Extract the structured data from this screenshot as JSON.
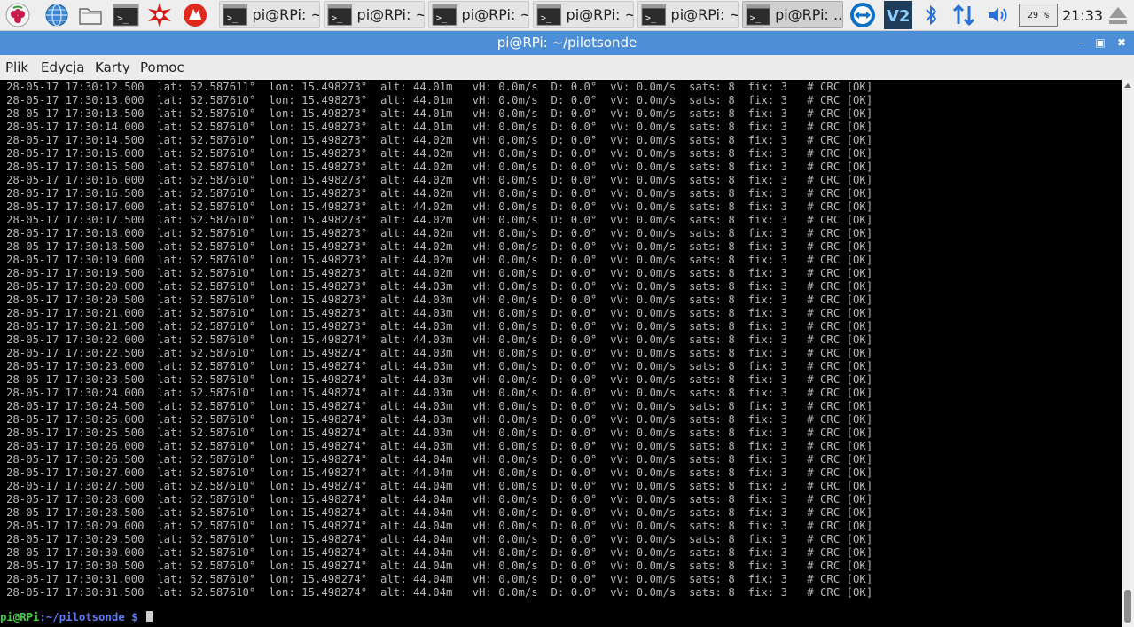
{
  "taskbar": {
    "tasks": [
      {
        "label": "pi@RPi: ~"
      },
      {
        "label": "pi@RPi: ~"
      },
      {
        "label": "pi@RPi: ~"
      },
      {
        "label": "pi@RPi: ~"
      },
      {
        "label": "pi@RPi: ~"
      },
      {
        "label": "pi@RPi: ..."
      }
    ],
    "battery": "29 %",
    "clock": "21:33"
  },
  "window": {
    "title": "pi@RPi: ~/pilotsonde"
  },
  "menu": {
    "items": [
      "Plik",
      "Edycja",
      "Karty",
      "Pomoc"
    ]
  },
  "terminal": {
    "lines": [
      "28-05-17 17:30:12.500  lat: 52.587611°  lon: 15.498273°  alt: 44.01m   vH: 0.0m/s  D: 0.0°  vV: 0.0m/s  sats: 8  fix: 3   # CRC [OK]",
      "28-05-17 17:30:13.000  lat: 52.587610°  lon: 15.498273°  alt: 44.01m   vH: 0.0m/s  D: 0.0°  vV: 0.0m/s  sats: 8  fix: 3   # CRC [OK]",
      "28-05-17 17:30:13.500  lat: 52.587610°  lon: 15.498273°  alt: 44.01m   vH: 0.0m/s  D: 0.0°  vV: 0.0m/s  sats: 8  fix: 3   # CRC [OK]",
      "28-05-17 17:30:14.000  lat: 52.587610°  lon: 15.498273°  alt: 44.01m   vH: 0.0m/s  D: 0.0°  vV: 0.0m/s  sats: 8  fix: 3   # CRC [OK]",
      "28-05-17 17:30:14.500  lat: 52.587610°  lon: 15.498273°  alt: 44.02m   vH: 0.0m/s  D: 0.0°  vV: 0.0m/s  sats: 8  fix: 3   # CRC [OK]",
      "28-05-17 17:30:15.000  lat: 52.587610°  lon: 15.498273°  alt: 44.02m   vH: 0.0m/s  D: 0.0°  vV: 0.0m/s  sats: 8  fix: 3   # CRC [OK]",
      "28-05-17 17:30:15.500  lat: 52.587610°  lon: 15.498273°  alt: 44.02m   vH: 0.0m/s  D: 0.0°  vV: 0.0m/s  sats: 8  fix: 3   # CRC [OK]",
      "28-05-17 17:30:16.000  lat: 52.587610°  lon: 15.498273°  alt: 44.02m   vH: 0.0m/s  D: 0.0°  vV: 0.0m/s  sats: 8  fix: 3   # CRC [OK]",
      "28-05-17 17:30:16.500  lat: 52.587610°  lon: 15.498273°  alt: 44.02m   vH: 0.0m/s  D: 0.0°  vV: 0.0m/s  sats: 8  fix: 3   # CRC [OK]",
      "28-05-17 17:30:17.000  lat: 52.587610°  lon: 15.498273°  alt: 44.02m   vH: 0.0m/s  D: 0.0°  vV: 0.0m/s  sats: 8  fix: 3   # CRC [OK]",
      "28-05-17 17:30:17.500  lat: 52.587610°  lon: 15.498273°  alt: 44.02m   vH: 0.0m/s  D: 0.0°  vV: 0.0m/s  sats: 8  fix: 3   # CRC [OK]",
      "28-05-17 17:30:18.000  lat: 52.587610°  lon: 15.498273°  alt: 44.02m   vH: 0.0m/s  D: 0.0°  vV: 0.0m/s  sats: 8  fix: 3   # CRC [OK]",
      "28-05-17 17:30:18.500  lat: 52.587610°  lon: 15.498273°  alt: 44.02m   vH: 0.0m/s  D: 0.0°  vV: 0.0m/s  sats: 8  fix: 3   # CRC [OK]",
      "28-05-17 17:30:19.000  lat: 52.587610°  lon: 15.498273°  alt: 44.02m   vH: 0.0m/s  D: 0.0°  vV: 0.0m/s  sats: 8  fix: 3   # CRC [OK]",
      "28-05-17 17:30:19.500  lat: 52.587610°  lon: 15.498273°  alt: 44.02m   vH: 0.0m/s  D: 0.0°  vV: 0.0m/s  sats: 8  fix: 3   # CRC [OK]",
      "28-05-17 17:30:20.000  lat: 52.587610°  lon: 15.498273°  alt: 44.03m   vH: 0.0m/s  D: 0.0°  vV: 0.0m/s  sats: 8  fix: 3   # CRC [OK]",
      "28-05-17 17:30:20.500  lat: 52.587610°  lon: 15.498273°  alt: 44.03m   vH: 0.0m/s  D: 0.0°  vV: 0.0m/s  sats: 8  fix: 3   # CRC [OK]",
      "28-05-17 17:30:21.000  lat: 52.587610°  lon: 15.498273°  alt: 44.03m   vH: 0.0m/s  D: 0.0°  vV: 0.0m/s  sats: 8  fix: 3   # CRC [OK]",
      "28-05-17 17:30:21.500  lat: 52.587610°  lon: 15.498273°  alt: 44.03m   vH: 0.0m/s  D: 0.0°  vV: 0.0m/s  sats: 8  fix: 3   # CRC [OK]",
      "28-05-17 17:30:22.000  lat: 52.587610°  lon: 15.498274°  alt: 44.03m   vH: 0.0m/s  D: 0.0°  vV: 0.0m/s  sats: 8  fix: 3   # CRC [OK]",
      "28-05-17 17:30:22.500  lat: 52.587610°  lon: 15.498274°  alt: 44.03m   vH: 0.0m/s  D: 0.0°  vV: 0.0m/s  sats: 8  fix: 3   # CRC [OK]",
      "28-05-17 17:30:23.000  lat: 52.587610°  lon: 15.498274°  alt: 44.03m   vH: 0.0m/s  D: 0.0°  vV: 0.0m/s  sats: 8  fix: 3   # CRC [OK]",
      "28-05-17 17:30:23.500  lat: 52.587610°  lon: 15.498274°  alt: 44.03m   vH: 0.0m/s  D: 0.0°  vV: 0.0m/s  sats: 8  fix: 3   # CRC [OK]",
      "28-05-17 17:30:24.000  lat: 52.587610°  lon: 15.498274°  alt: 44.03m   vH: 0.0m/s  D: 0.0°  vV: 0.0m/s  sats: 8  fix: 3   # CRC [OK]",
      "28-05-17 17:30:24.500  lat: 52.587610°  lon: 15.498274°  alt: 44.03m   vH: 0.0m/s  D: 0.0°  vV: 0.0m/s  sats: 8  fix: 3   # CRC [OK]",
      "28-05-17 17:30:25.000  lat: 52.587610°  lon: 15.498274°  alt: 44.03m   vH: 0.0m/s  D: 0.0°  vV: 0.0m/s  sats: 8  fix: 3   # CRC [OK]",
      "28-05-17 17:30:25.500  lat: 52.587610°  lon: 15.498274°  alt: 44.03m   vH: 0.0m/s  D: 0.0°  vV: 0.0m/s  sats: 8  fix: 3   # CRC [OK]",
      "28-05-17 17:30:26.000  lat: 52.587610°  lon: 15.498274°  alt: 44.03m   vH: 0.0m/s  D: 0.0°  vV: 0.0m/s  sats: 8  fix: 3   # CRC [OK]",
      "28-05-17 17:30:26.500  lat: 52.587610°  lon: 15.498274°  alt: 44.04m   vH: 0.0m/s  D: 0.0°  vV: 0.0m/s  sats: 8  fix: 3   # CRC [OK]",
      "28-05-17 17:30:27.000  lat: 52.587610°  lon: 15.498274°  alt: 44.04m   vH: 0.0m/s  D: 0.0°  vV: 0.0m/s  sats: 8  fix: 3   # CRC [OK]",
      "28-05-17 17:30:27.500  lat: 52.587610°  lon: 15.498274°  alt: 44.04m   vH: 0.0m/s  D: 0.0°  vV: 0.0m/s  sats: 8  fix: 3   # CRC [OK]",
      "28-05-17 17:30:28.000  lat: 52.587610°  lon: 15.498274°  alt: 44.04m   vH: 0.0m/s  D: 0.0°  vV: 0.0m/s  sats: 8  fix: 3   # CRC [OK]",
      "28-05-17 17:30:28.500  lat: 52.587610°  lon: 15.498274°  alt: 44.04m   vH: 0.0m/s  D: 0.0°  vV: 0.0m/s  sats: 8  fix: 3   # CRC [OK]",
      "28-05-17 17:30:29.000  lat: 52.587610°  lon: 15.498274°  alt: 44.04m   vH: 0.0m/s  D: 0.0°  vV: 0.0m/s  sats: 8  fix: 3   # CRC [OK]",
      "28-05-17 17:30:29.500  lat: 52.587610°  lon: 15.498274°  alt: 44.04m   vH: 0.0m/s  D: 0.0°  vV: 0.0m/s  sats: 8  fix: 3   # CRC [OK]",
      "28-05-17 17:30:30.000  lat: 52.587610°  lon: 15.498274°  alt: 44.04m   vH: 0.0m/s  D: 0.0°  vV: 0.0m/s  sats: 8  fix: 3   # CRC [OK]",
      "28-05-17 17:30:30.500  lat: 52.587610°  lon: 15.498274°  alt: 44.04m   vH: 0.0m/s  D: 0.0°  vV: 0.0m/s  sats: 8  fix: 3   # CRC [OK]",
      "28-05-17 17:30:31.000  lat: 52.587610°  lon: 15.498274°  alt: 44.04m   vH: 0.0m/s  D: 0.0°  vV: 0.0m/s  sats: 8  fix: 3   # CRC [OK]",
      "28-05-17 17:30:31.500  lat: 52.587610°  lon: 15.498274°  alt: 44.04m   vH: 0.0m/s  D: 0.0°  vV: 0.0m/s  sats: 8  fix: 3   # CRC [OK]"
    ],
    "prompt_user": "pi@RPi",
    "prompt_path": ":~/pilotsonde",
    "prompt_symbol": " $ "
  }
}
